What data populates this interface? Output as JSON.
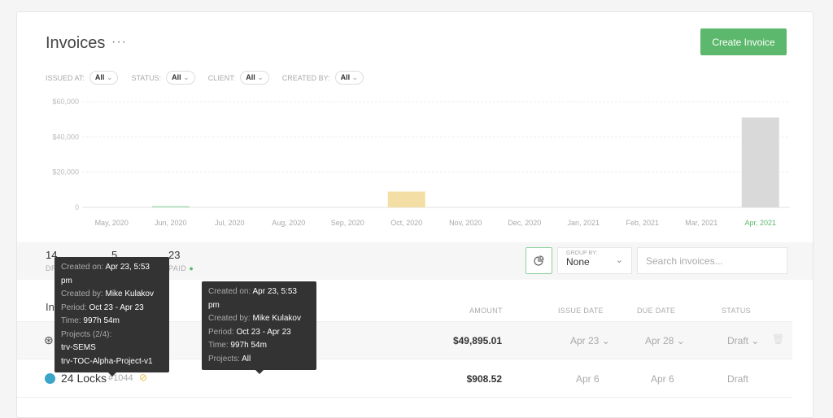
{
  "header": {
    "title": "Invoices",
    "more": "···",
    "create_label": "Create Invoice"
  },
  "filters": [
    {
      "label": "ISSUED AT:",
      "value": "All"
    },
    {
      "label": "STATUS:",
      "value": "All"
    },
    {
      "label": "CLIENT:",
      "value": "All"
    },
    {
      "label": "CREATED BY:",
      "value": "All"
    }
  ],
  "chart_data": {
    "type": "bar",
    "categories": [
      "May, 2020",
      "Jun, 2020",
      "Jul, 2020",
      "Aug, 2020",
      "Sep, 2020",
      "Oct, 2020",
      "Nov, 2020",
      "Dec, 2020",
      "Jan, 2021",
      "Feb, 2021",
      "Mar, 2021",
      "Apr, 2021"
    ],
    "values": [
      0,
      500,
      0,
      0,
      0,
      9000,
      0,
      0,
      0,
      0,
      0,
      51000
    ],
    "colors": [
      "#cccccc",
      "#a8dbb4",
      "#cccccc",
      "#cccccc",
      "#cccccc",
      "#f3dfa6",
      "#cccccc",
      "#cccccc",
      "#cccccc",
      "#cccccc",
      "#cccccc",
      "#d9d9d9"
    ],
    "yticks": [
      "0",
      "$20,000",
      "$40,000",
      "$60,000"
    ],
    "ylim": [
      0,
      60000
    ],
    "grid": true,
    "highlight_category": "Apr, 2021",
    "highlight_color": "#5cb86c"
  },
  "stats": [
    {
      "value": "14",
      "label": "DRAFT"
    },
    {
      "value": "5",
      "label": ""
    },
    {
      "value": "23",
      "label": "PAID"
    }
  ],
  "toolbar": {
    "group_label": "GROUP BY:",
    "group_value": "None",
    "search_placeholder": "Search invoices..."
  },
  "table": {
    "headers": [
      "Invoice",
      "AMOUNT",
      "ISSUE DATE",
      "DUE DATE",
      "STATUS"
    ],
    "rows": [
      {
        "client": "",
        "number": "",
        "amount": "$49,895.01",
        "issue": "Apr 23",
        "due": "Apr 28",
        "status": "Draft"
      },
      {
        "client": "24 Locks",
        "number": "#1044",
        "amount": "$908.52",
        "issue": "Apr 6",
        "due": "Apr 6",
        "status": "Draft"
      }
    ]
  },
  "tooltips": [
    {
      "created_on": "Apr 23, 5:53 pm",
      "created_by": "Mike Kulakov",
      "period": "Oct 23 - Apr 23",
      "time": "997h 54m",
      "projects_label": "Projects (2/4):",
      "projects": [
        "trv-SEMS",
        "trv-TOC-Alpha-Project-v1"
      ]
    },
    {
      "created_on": "Apr 23, 5:53 pm",
      "created_by": "Mike Kulakov",
      "period": "Oct 23 - Apr 23",
      "time": "997h 54m",
      "projects_label": "Projects:",
      "projects_value": "All"
    }
  ],
  "tooltip_keys": {
    "created_on": "Created on:",
    "created_by": "Created by:",
    "period": "Period:",
    "time": "Time:"
  }
}
